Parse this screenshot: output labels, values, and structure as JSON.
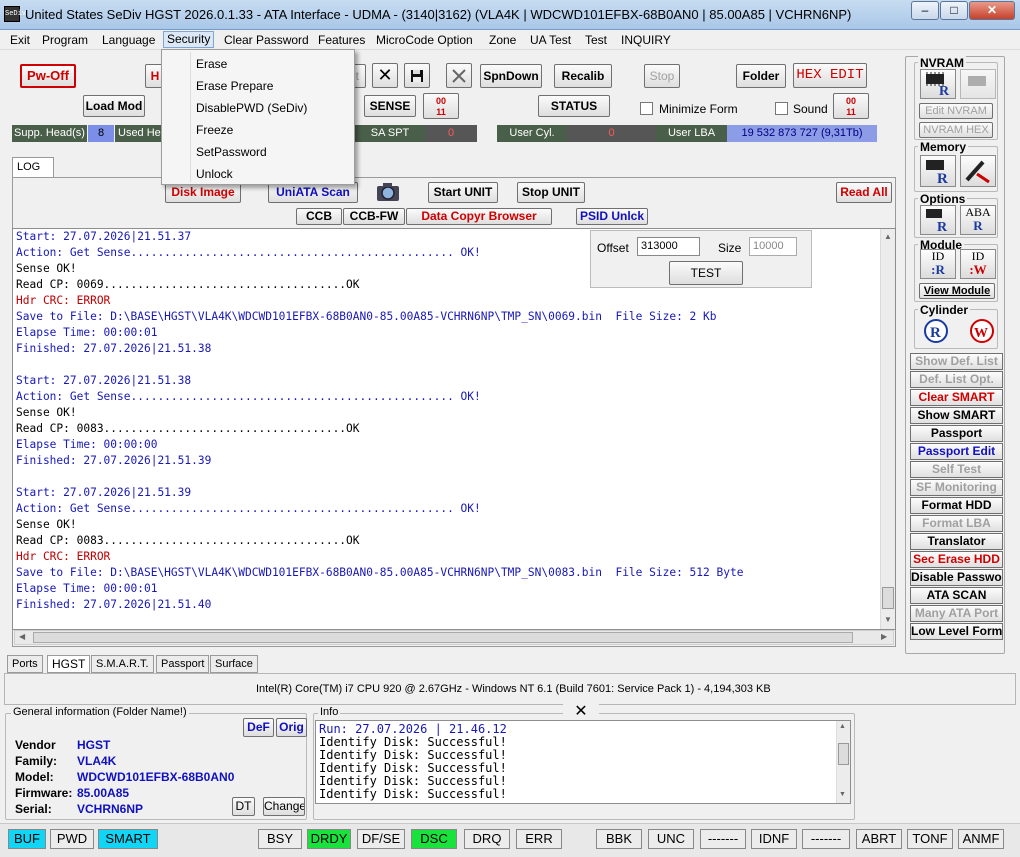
{
  "window": {
    "title": "United States  SeDiv HGST  2026.0.1.33 - ATA Interface  - UDMA -  (3140|3162) (VLA4K | WDCWD101EFBX-68B0AN0 | 85.00A85 | VCHRN6NP)",
    "icon_text": "SeDiv",
    "minimize": "–",
    "maximize": "□",
    "close": "✕"
  },
  "menu": [
    "Exit",
    "Program",
    "Language",
    "Security",
    "Clear Password",
    "Features",
    "MicroCode Option",
    "Zone",
    "UA Test",
    "Test",
    "INQUIRY"
  ],
  "security_menu": [
    "Erase",
    "Erase Prepare",
    "DisablePWD (SeDiv)",
    "Freeze",
    "SetPassword",
    "Unlock"
  ],
  "toolbar": {
    "pw_off": "Pw-Off",
    "h_partial": "H",
    "load_mod": "Load Mod",
    "et_partial": "et",
    "sense": "SENSE",
    "spindown": "SpnDown",
    "recalib": "Recalib",
    "stop": "Stop",
    "status": "STATUS",
    "minimize_form": "Minimize Form",
    "sound": "Sound",
    "folder": "Folder",
    "hex_edit": "HEX EDIT",
    "x_icon": "✕",
    "save_icon": "💾",
    "wrench_icon": "✂",
    "badge1": "00\n11",
    "badge2": "00\n11"
  },
  "status_strip": {
    "supp_heads": "Supp. Head(s)",
    "supp_heads_val": "8",
    "used_heads": "Used He",
    "sa_spt": "SA SPT",
    "sa_spt_val": "0",
    "user_cyl": "User Cyl.",
    "user_cyl_val": "0",
    "user_lba": "User LBA",
    "user_lba_val": "19 532 873 727  (9,31Tb)"
  },
  "log_tab": "LOG",
  "buttons2": {
    "disk_image": "Disk Image",
    "uniata_scan": "UniATA Scan",
    "start_unit": "Start UNIT",
    "stop_unit": "Stop UNIT",
    "read_all": "Read All",
    "ccb": "CCB",
    "ccb_fw": "CCB-FW",
    "data_copyr": "Data Copyr Browser",
    "psid": "PSID Unlck"
  },
  "offset_panel": {
    "offset_label": "Offset",
    "offset_value": "313000",
    "size_label": "Size",
    "size_value": "10000",
    "test": "TEST"
  },
  "log_lines": [
    {
      "t": "Start: 27.07.2026|21.51.37",
      "c": "c-blue"
    },
    {
      "t": "Action: Get Sense................................................ OK!",
      "c": "c-blue"
    },
    {
      "t": "Sense OK!",
      "c": "c-blk"
    },
    {
      "t": "Read CP: 0069....................................OK",
      "c": "c-blk"
    },
    {
      "t": "Hdr CRC: ERROR",
      "c": "c-red"
    },
    {
      "t": "Save to File: D:\\BASE\\HGST\\VLA4K\\WDCWD101EFBX-68B0AN0-85.00A85-VCHRN6NP\\TMP_SN\\0069.bin  File Size: 2 Kb",
      "c": "c-blue"
    },
    {
      "t": "Elapse Time: 00:00:01",
      "c": "c-blue"
    },
    {
      "t": "Finished: 27.07.2026|21.51.38",
      "c": "c-blue"
    },
    {
      "t": "",
      "c": "c-blk"
    },
    {
      "t": "Start: 27.07.2026|21.51.38",
      "c": "c-blue"
    },
    {
      "t": "Action: Get Sense................................................ OK!",
      "c": "c-blue"
    },
    {
      "t": "Sense OK!",
      "c": "c-blk"
    },
    {
      "t": "Read CP: 0083....................................OK",
      "c": "c-blk"
    },
    {
      "t": "Elapse Time: 00:00:00",
      "c": "c-blue"
    },
    {
      "t": "Finished: 27.07.2026|21.51.39",
      "c": "c-blue"
    },
    {
      "t": "",
      "c": "c-blk"
    },
    {
      "t": "Start: 27.07.2026|21.51.39",
      "c": "c-blue"
    },
    {
      "t": "Action: Get Sense................................................ OK!",
      "c": "c-blue"
    },
    {
      "t": "Sense OK!",
      "c": "c-blk"
    },
    {
      "t": "Read CP: 0083....................................OK",
      "c": "c-blk"
    },
    {
      "t": "Hdr CRC: ERROR",
      "c": "c-red"
    },
    {
      "t": "Save to File: D:\\BASE\\HGST\\VLA4K\\WDCWD101EFBX-68B0AN0-85.00A85-VCHRN6NP\\TMP_SN\\0083.bin  File Size: 512 Byte",
      "c": "c-blue"
    },
    {
      "t": "Elapse Time: 00:00:01",
      "c": "c-blue"
    },
    {
      "t": "Finished: 27.07.2026|21.51.40",
      "c": "c-blue"
    }
  ],
  "bottom_tabs": [
    "Ports",
    "HGST",
    "S.M.A.R.T.",
    "Passport",
    "Surface"
  ],
  "sysinfo": "Intel(R) Core(TM) i7 CPU 920  @ 2.67GHz - Windows NT 6.1 (Build 7601: Service Pack 1) -  4,194,303 KB",
  "general": {
    "title": "General information (Folder Name!)",
    "def": "DeF",
    "orig": "Orig",
    "dt": "DT",
    "change": "Change",
    "rows": [
      {
        "k": "Vendor",
        "v": "HGST"
      },
      {
        "k": "Family:",
        "v": "VLA4K"
      },
      {
        "k": "Model:",
        "v": "WDCWD101EFBX-68B0AN0"
      },
      {
        "k": "Firmware:",
        "v": "85.00A85"
      },
      {
        "k": "Serial:",
        "v": "VCHRN6NP"
      }
    ]
  },
  "info": {
    "title": "Info",
    "close": "✕",
    "lines": [
      "Run: 27.07.2026 | 21.46.12",
      "Identify Disk: Successful!",
      "Identify Disk: Successful!",
      "Identify Disk: Successful!",
      "Identify Disk: Successful!",
      "Identify Disk: Successful!"
    ]
  },
  "right_panel": {
    "nvram": "NVRAM",
    "edit_nvram": "Edit NVRAM",
    "nvram_hex": "NVRAM HEX",
    "memory": "Memory",
    "options": "Options",
    "aba": "ABA",
    "module": "Module",
    "id": "ID",
    "view_module": "View Module",
    "cylinder": "Cylinder",
    "list": [
      {
        "t": "Show Def. List",
        "s": "gray"
      },
      {
        "t": "Def. List Opt.",
        "s": "gray"
      },
      {
        "t": "Clear SMART",
        "s": "red"
      },
      {
        "t": "Show SMART",
        "s": "n"
      },
      {
        "t": "Passport",
        "s": "n"
      },
      {
        "t": "Passport Edit",
        "s": "blue"
      },
      {
        "t": "Self Test",
        "s": "gray"
      },
      {
        "t": "SF Monitoring",
        "s": "gray"
      },
      {
        "t": "Format HDD",
        "s": "n"
      },
      {
        "t": "Format LBA",
        "s": "gray"
      },
      {
        "t": "Translator",
        "s": "n"
      },
      {
        "t": "Sec Erase HDD",
        "s": "red"
      },
      {
        "t": "Disable Password",
        "s": "n"
      },
      {
        "t": "ATA SCAN",
        "s": "n"
      },
      {
        "t": "Many ATA Port",
        "s": "gray"
      },
      {
        "t": "Low Level Format",
        "s": "n"
      }
    ]
  },
  "statusbar": [
    {
      "t": "BUF",
      "c": "on-cyan"
    },
    {
      "t": "PWD",
      "c": ""
    },
    {
      "t": "SMART",
      "c": "on-cyan"
    },
    {
      "t": "BSY",
      "c": ""
    },
    {
      "t": "DRDY",
      "c": "on-green"
    },
    {
      "t": "DF/SE",
      "c": ""
    },
    {
      "t": "DSC",
      "c": "on-green"
    },
    {
      "t": "DRQ",
      "c": ""
    },
    {
      "t": "ERR",
      "c": ""
    },
    {
      "t": "BBK",
      "c": ""
    },
    {
      "t": "UNC",
      "c": ""
    },
    {
      "t": "-------",
      "c": ""
    },
    {
      "t": "IDNF",
      "c": ""
    },
    {
      "t": "-------",
      "c": ""
    },
    {
      "t": "ABRT",
      "c": ""
    },
    {
      "t": "TONF",
      "c": ""
    },
    {
      "t": "ANMF",
      "c": ""
    }
  ],
  "colors": {
    "accent": "#11d5f4",
    "ok": "#18e23b",
    "error": "#c00000",
    "log_blue": "#1818b8"
  }
}
